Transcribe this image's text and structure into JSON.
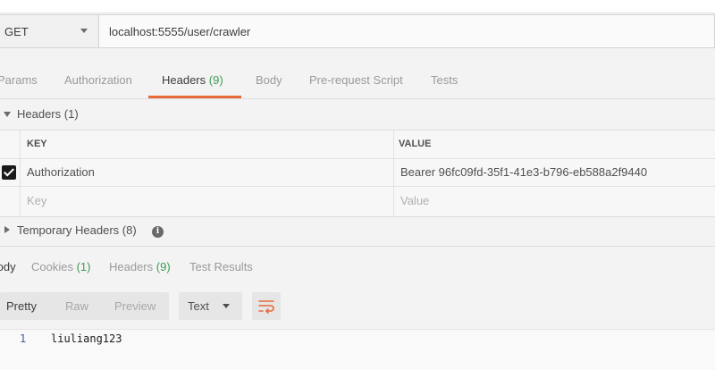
{
  "request": {
    "method": "GET",
    "url": "localhost:5555/user/crawler"
  },
  "request_tabs": [
    {
      "label": "Params",
      "count": ""
    },
    {
      "label": "Authorization",
      "count": ""
    },
    {
      "label": "Headers",
      "count": "(9)",
      "active": true
    },
    {
      "label": "Body",
      "count": ""
    },
    {
      "label": "Pre-request Script",
      "count": ""
    },
    {
      "label": "Tests",
      "count": ""
    }
  ],
  "headers_section": {
    "title": "Headers",
    "count": "(1)",
    "columns": {
      "key": "KEY",
      "value": "VALUE"
    },
    "rows": [
      {
        "checked": true,
        "key": "Authorization",
        "value": "Bearer  96fc09fd-35f1-41e3-b796-eb588a2f9440"
      }
    ],
    "placeholder": {
      "key": "Key",
      "value": "Value"
    }
  },
  "temporary_headers": {
    "title": "Temporary Headers",
    "count": "(8)",
    "icon": "info-icon"
  },
  "response_tabs": [
    {
      "label": "Body",
      "count": "",
      "active": true
    },
    {
      "label": "Cookies",
      "count": "(1)"
    },
    {
      "label": "Headers",
      "count": "(9)"
    },
    {
      "label": "Test Results",
      "count": ""
    }
  ],
  "response_view": {
    "formats": [
      "Pretty",
      "Raw",
      "Preview"
    ],
    "active_format": "Pretty",
    "language": "Text",
    "wrap_icon": "wrap-lines-icon"
  },
  "response_body": {
    "lines": [
      {
        "number": "1",
        "text": "liuliang123"
      }
    ]
  },
  "colors": {
    "accent": "#e8693a",
    "count_green": "#3c9c52"
  }
}
